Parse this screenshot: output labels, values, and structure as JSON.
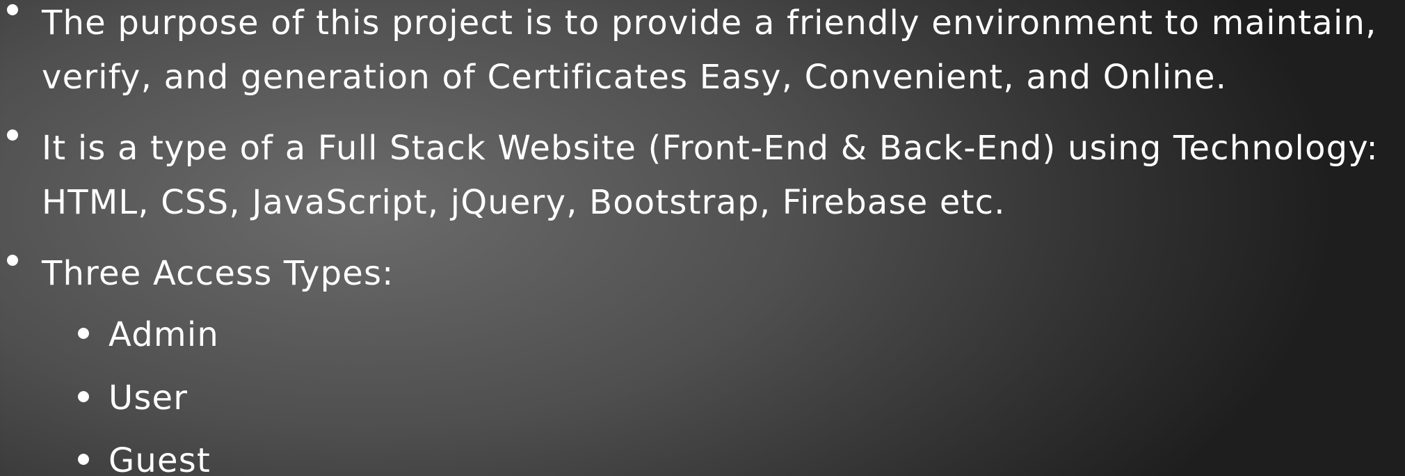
{
  "slide": {
    "bullets": [
      {
        "text": "The purpose of this project is to provide a friendly environment to maintain, verify, and generation of Certificates Easy, Convenient, and Online."
      },
      {
        "text": "It is a type of a Full Stack Website (Front-End & Back-End) using Technology: HTML, CSS, JavaScript, jQuery, Bootstrap, Firebase etc."
      },
      {
        "text": "Three Access Types:"
      }
    ],
    "sub_bullets": [
      {
        "text": "Admin"
      },
      {
        "text": "User"
      },
      {
        "text": "Guest"
      }
    ]
  }
}
